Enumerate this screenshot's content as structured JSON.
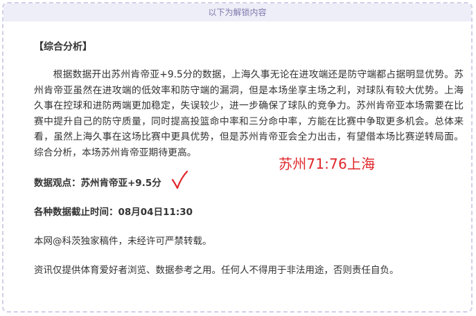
{
  "panel": {
    "header_label": "以下为解锁内容"
  },
  "article": {
    "section_title": "【综合分析】",
    "paragraph": "根据数据开出苏州肯帝亚+9.5分的数据，上海久事无论在进攻端还是防守端都占据明显优势。苏州肯帝亚虽然在进攻端的低效率和防守端的漏洞，但是本场坐享主场之利，对球队有较大优势。上海久事在控球和进防两端更加稳定，失误较少，进一步确保了球队的竞争力。苏州肯帝亚本场需要在比赛中提升自己的防守质量，同时提高投篮命中率和三分命中率，方能在比赛中争取更多机会。总体来看，虽然上海久事在这场比赛中更具优势，但是苏州肯帝亚会全力出击，有望借本场比赛逆转局面。综合分析，本场苏州肯帝亚期待更高。",
    "data_point": "数据观点：苏州肯帝亚+9.5分",
    "cutoff_time": "各种数据截止时间：08月04日11:30",
    "copyright": "本网@科茨独家稿件，未经许可严禁转载。",
    "disclaimer": "资讯仅提供体育爱好者浏览、数据参考之用。任何人不得用于非法用途，否则责任自负。"
  },
  "annotation": {
    "score_text": "苏州71:76上海",
    "color": "#e0262a",
    "check_icon": "checkmark-icon"
  }
}
